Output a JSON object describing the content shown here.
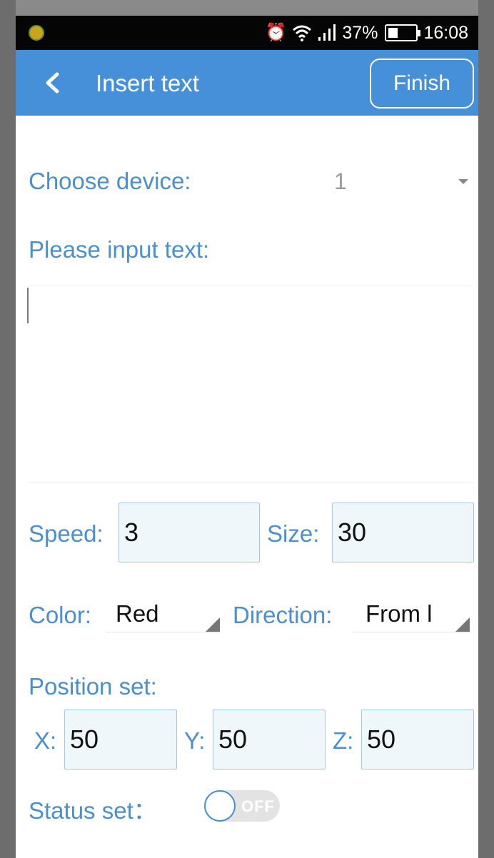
{
  "statusbar": {
    "battery": "37%",
    "battery_level": 0.37,
    "time": "16:08",
    "icons": [
      "app-notification-icon",
      "alarm-icon",
      "wifi-icon",
      "signal-icon",
      "battery-icon"
    ]
  },
  "header": {
    "title": "Insert text",
    "finish_label": "Finish",
    "color": "#4590d8"
  },
  "form": {
    "device_label": "Choose device:",
    "device_value": "1",
    "text_label": "Please input text:",
    "text_value": "",
    "speed_label": "Speed:",
    "speed_value": "3",
    "size_label": "Size:",
    "size_value": "30",
    "color_label": "Color:",
    "color_value": "Red",
    "direction_label": "Direction:",
    "direction_value": "From l",
    "position_label": "Position set:",
    "x_label": "X:",
    "x_value": "50",
    "y_label": "Y:",
    "y_value": "50",
    "z_label": "Z:",
    "z_value": "50",
    "status_label": "Status set：",
    "status_toggle": "OFF"
  },
  "colors": {
    "label": "#4a8fd0",
    "field_bg": "#f0f7fb",
    "field_border": "#9fc9e4"
  }
}
